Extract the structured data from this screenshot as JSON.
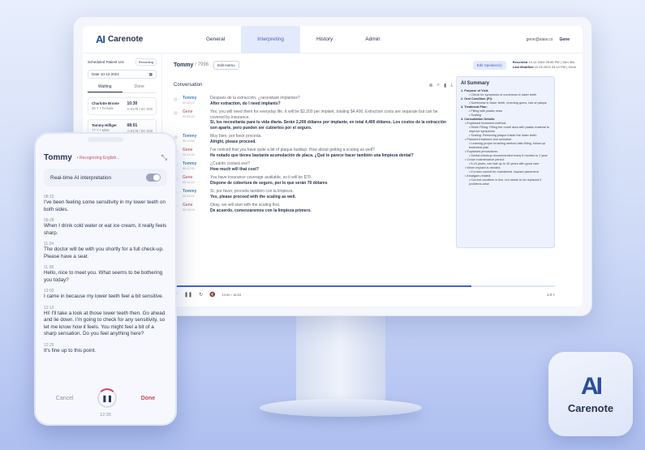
{
  "app": {
    "logo_mark": "AI",
    "logo_text": "Carenote"
  },
  "nav": {
    "tabs": [
      "General",
      "Interpreting",
      "History",
      "Admin"
    ],
    "active": 1,
    "user_email": "gene@aiaw.co",
    "user_name": "Gene"
  },
  "left": {
    "title": "Scheduled Patient List",
    "button": "Recording",
    "date": "Date 10-12-2024",
    "tabs": [
      "Waiting",
      "Done"
    ],
    "patients": [
      {
        "name": "Charlotte Bronte",
        "detail": "35 Y • Female",
        "time": "10:30",
        "code": "A-0178 / 0C-000"
      },
      {
        "name": "Tommy Hilfiger",
        "detail": "77 Y • Male",
        "time": "08:01",
        "code": "A-0178 / 0C-020"
      }
    ]
  },
  "header": {
    "name": "Tommy",
    "id": "/ 7996",
    "edit_button": "Edit memo",
    "speaker_button": "Edit Speaker(s)",
    "recorded_label": "Recorded",
    "recorded_value": "10.12.2024 05:55 PM | 15m 49s",
    "modified_label": "Last Modified",
    "modified_value": "10.25.2024 03:10 PM | Gene"
  },
  "conversation": {
    "title": "Conversation",
    "messages": [
      {
        "who": "Tommy",
        "time": "00:05:12",
        "src": "Después de la extracción, ¿necesitaré implantes?",
        "tr": "After extraction, do I need implants?"
      },
      {
        "who": "Gene",
        "time": "00:05:20",
        "src": "Yes, you will need them for everyday life. It will be $2,200 per implant, totaling $4,400. Extraction costs are separate but can be covered by insurance.",
        "tr": "Sí, los necesitarás para tu vida diaria. Serán 2,200 dólares por implante, en total 4,400 dólares. Los costos de la extracción son aparte, pero pueden ser cubiertos por el seguro."
      },
      {
        "who": "Tommy",
        "time": "00:11:08",
        "src": "Muy bien, por favor proceda.",
        "tr": "Alright, please proceed."
      },
      {
        "who": "Gene",
        "time": "00:11:18",
        "src": "I've noticed that you have quite a bit of plaque buildup. How about getting a scaling as well?",
        "tr": "He notado que tienes bastante acumulación de placa. ¿Qué te parece hacer también una limpieza dental?"
      },
      {
        "who": "Tommy",
        "time": "00:12:00",
        "src": "¿Cuánto costará eso?",
        "tr": "How much will that cost?"
      },
      {
        "who": "Gene",
        "time": "00:12:10",
        "src": "You have insurance coverage available, so it will be $70.",
        "tr": "Dispone de cobertura de seguro, por lo que serán 70 dólares"
      },
      {
        "who": "Tommy",
        "time": "00:12:22",
        "src": "Sí, por favor, proceda también con la limpieza.",
        "tr": "Yes, please proceed with the scaling as well."
      },
      {
        "who": "Gene",
        "time": "00:13:03",
        "src": "Okay, we will start with the scaling first.",
        "tr": "De acuerdo, comenzaremos con la limpieza primero."
      }
    ]
  },
  "player": {
    "time": "12:50 / 15:53",
    "speed": "1.0 ×",
    "progress": 0.78
  },
  "summary": {
    "title": "AI Summary",
    "lines": [
      {
        "t": "1. Purpose of Visit:",
        "c": "b"
      },
      {
        "t": "• Check for symptoms of numbness in lower teeth",
        "c": "i2"
      },
      {
        "t": "2. Oral Condition (PI):",
        "c": "b"
      },
      {
        "t": "• Numbness in lower teeth, receding gums, lots of plaque",
        "c": "i2"
      },
      {
        "t": "3. Treatment Plan:",
        "c": "b"
      },
      {
        "t": "• Filling with plastic resin",
        "c": "i2"
      },
      {
        "t": "• Scaling",
        "c": "i2"
      },
      {
        "t": "4. Consultation Details:",
        "c": "b"
      },
      {
        "t": "• Explained treatment method:",
        "c": "i1"
      },
      {
        "t": "• Resin Filling: Filling the numb area with plastic material to improve symptoms",
        "c": "i2"
      },
      {
        "t": "• Scaling: Removing plaque inside the lower teeth",
        "c": "i2"
      },
      {
        "t": "• Planned treatment and schedule:",
        "c": "i1"
      },
      {
        "t": "• Learning proper brushing method after filling, follow-up treatment plan",
        "c": "i2"
      },
      {
        "t": "• Explained precautions:",
        "c": "i1"
      },
      {
        "t": "• Dental checkup recommended every 6 months to 1 year",
        "c": "i2"
      },
      {
        "t": "• Crown maintenance period:",
        "c": "i1"
      },
      {
        "t": "• 5-10 years, can last up to 40 years with good care",
        "c": "i2"
      },
      {
        "t": "• When implant is needed:",
        "c": "i1"
      },
      {
        "t": "• If crown cannot be maintained, implant placement",
        "c": "i2"
      },
      {
        "t": "• Amalgam-related:",
        "c": "i1"
      },
      {
        "t": "• Current condition is fine, but needs to be replaced if problems arise",
        "c": "i2"
      }
    ]
  },
  "phone": {
    "name": "Tommy",
    "status": "• Recognizing English...",
    "toggle_label": "Real-time AI interpretation",
    "messages": [
      {
        "time": "08:15",
        "text": "I've been feeling some sensitivity in my lower teeth on both sides."
      },
      {
        "time": "09:28",
        "text": "When I drink cold water or eat ice cream, it really feels sharp."
      },
      {
        "time": "11:24",
        "text": "The doctor will be with you shortly for a full check-up. Please have a seat."
      },
      {
        "time": "11:38",
        "text": "Hello, nice to meet you. What seems to be bothering you today?"
      },
      {
        "time": "12:02",
        "text": "I came in because my lower teeth feel a bit sensitive."
      },
      {
        "time": "12:10",
        "text": "Hi! I'll take a look at those lower teeth then. Go ahead and lie down. I'm going to check for any sensitivity, so let me know how it feels. You might feel a bit of a sharp sensation. Do you feel anything here?"
      },
      {
        "time": "12:25",
        "text": "It's fine up to this point."
      }
    ],
    "cancel": "Cancel",
    "done": "Done",
    "clock": "12:35"
  },
  "tile": {
    "mark": "AI",
    "text": "Carenote"
  }
}
